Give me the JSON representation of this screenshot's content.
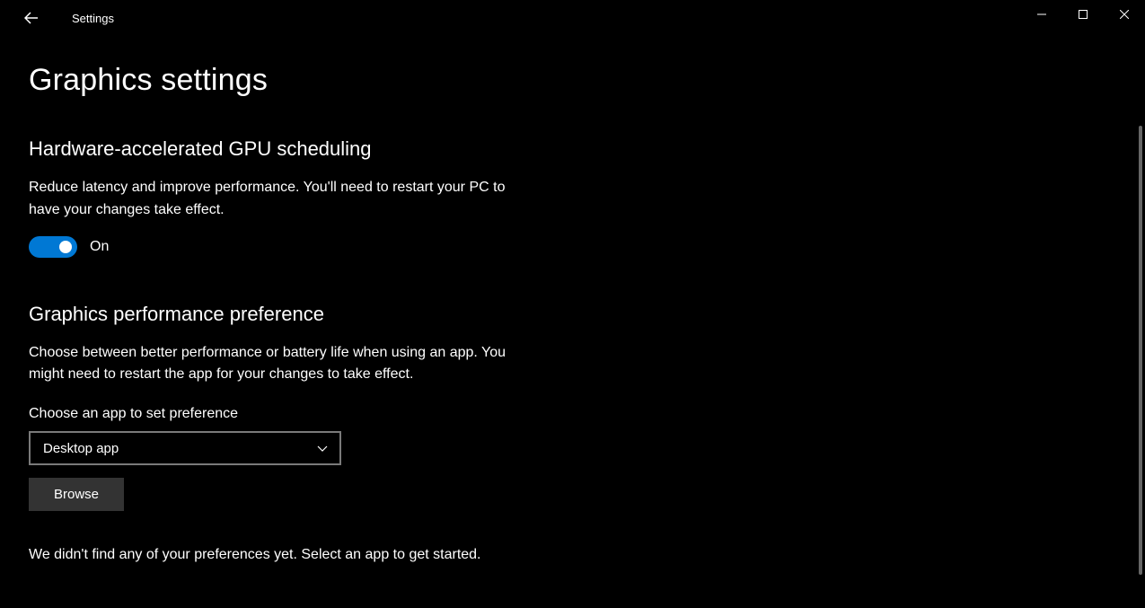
{
  "window": {
    "title": "Settings"
  },
  "page": {
    "title": "Graphics settings"
  },
  "gpu_section": {
    "heading": "Hardware-accelerated GPU scheduling",
    "description": "Reduce latency and improve performance. You'll need to restart your PC to have your changes take effect.",
    "toggle_state": "On"
  },
  "perf_section": {
    "heading": "Graphics performance preference",
    "description": "Choose between better performance or battery life when using an app. You might need to restart the app for your changes to take effect.",
    "field_label": "Choose an app to set preference",
    "dropdown_value": "Desktop app",
    "browse_label": "Browse",
    "empty_message": "We didn't find any of your preferences yet. Select an app to get started."
  },
  "colors": {
    "accent": "#0078d4",
    "background": "#000000",
    "text": "#ffffff"
  }
}
